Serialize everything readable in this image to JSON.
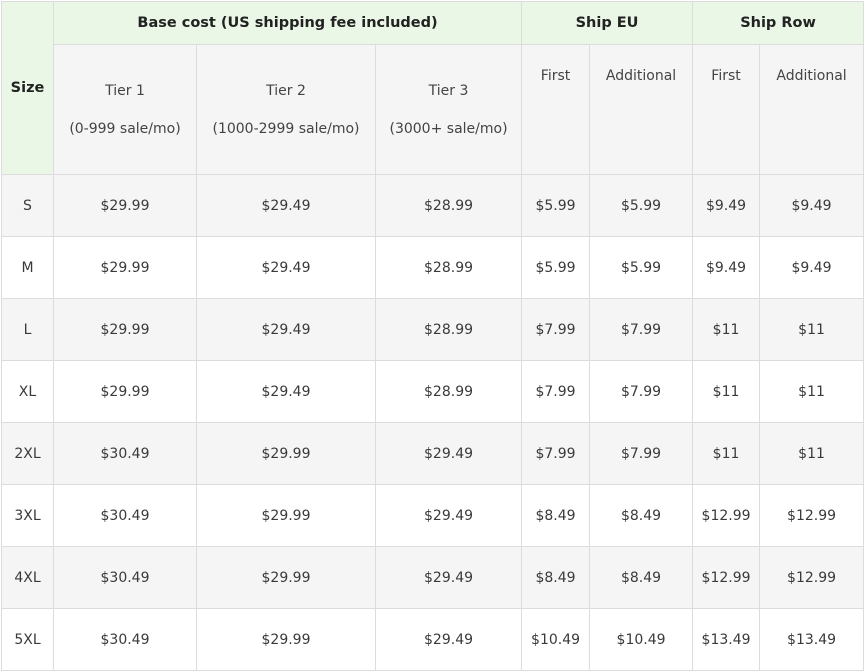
{
  "header": {
    "size": "Size",
    "base_cost": "Base cost (US shipping fee included)",
    "ship_eu": "Ship EU",
    "ship_row": "Ship Row"
  },
  "subheader": {
    "tier1_name": "Tier 1",
    "tier1_range": "(0-999 sale/mo)",
    "tier2_name": "Tier 2",
    "tier2_range": "(1000-2999 sale/mo)",
    "tier3_name": "Tier 3",
    "tier3_range": "(3000+ sale/mo)",
    "eu_first": "First",
    "eu_additional": "Additional",
    "row_first": "First",
    "row_additional": "Additional"
  },
  "rows": [
    [
      "S",
      "$29.99",
      "$29.49",
      "$28.99",
      "$5.99",
      "$5.99",
      "$9.49",
      "$9.49"
    ],
    [
      "M",
      "$29.99",
      "$29.49",
      "$28.99",
      "$5.99",
      "$5.99",
      "$9.49",
      "$9.49"
    ],
    [
      "L",
      "$29.99",
      "$29.49",
      "$28.99",
      "$7.99",
      "$7.99",
      "$11",
      "$11"
    ],
    [
      "XL",
      "$29.99",
      "$29.49",
      "$28.99",
      "$7.99",
      "$7.99",
      "$11",
      "$11"
    ],
    [
      "2XL",
      "$30.49",
      "$29.99",
      "$29.49",
      "$7.99",
      "$7.99",
      "$11",
      "$11"
    ],
    [
      "3XL",
      "$30.49",
      "$29.99",
      "$29.49",
      "$8.49",
      "$8.49",
      "$12.99",
      "$12.99"
    ],
    [
      "4XL",
      "$30.49",
      "$29.99",
      "$29.49",
      "$8.49",
      "$8.49",
      "$12.99",
      "$12.99"
    ],
    [
      "5XL",
      "$30.49",
      "$29.99",
      "$29.49",
      "$10.49",
      "$10.49",
      "$13.49",
      "$13.49"
    ]
  ]
}
